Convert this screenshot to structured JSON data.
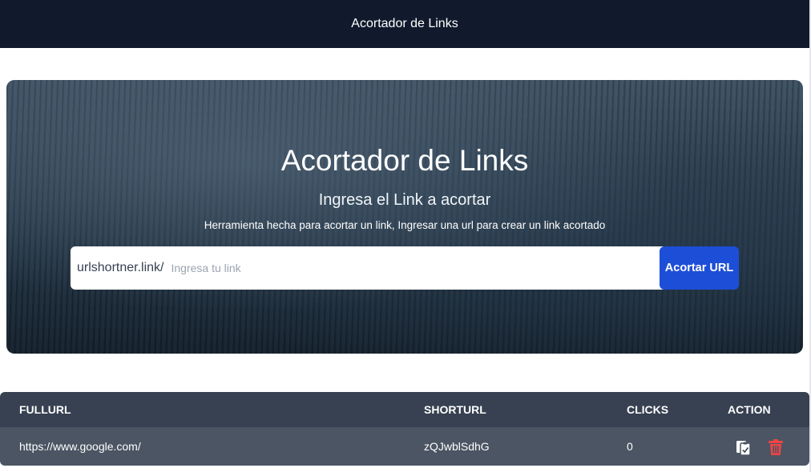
{
  "header": {
    "title": "Acortador de Links"
  },
  "hero": {
    "title": "Acortador de Links",
    "subtitle": "Ingresa el Link a acortar",
    "description": "Herramienta hecha para acortar un link, Ingresar una url para crear un link acortado"
  },
  "form": {
    "prefix": "urlshortner.link/",
    "placeholder": "Ingresa tu link",
    "value": "",
    "button_label": "Acortar URL"
  },
  "table": {
    "headers": [
      "FULLURL",
      "SHORTURL",
      "CLICKS",
      "ACTION"
    ],
    "rows": [
      {
        "fullurl": "https://www.google.com/",
        "shorturl": "zQJwblSdhG",
        "clicks": "0",
        "actions": [
          "copy-icon",
          "trash-icon"
        ]
      }
    ]
  },
  "colors": {
    "header_bg": "#111a2d",
    "button_bg": "#1d4ed8",
    "table_head_bg": "#374151",
    "table_row_bg": "#4b5563",
    "delete_icon": "#ef4444"
  }
}
